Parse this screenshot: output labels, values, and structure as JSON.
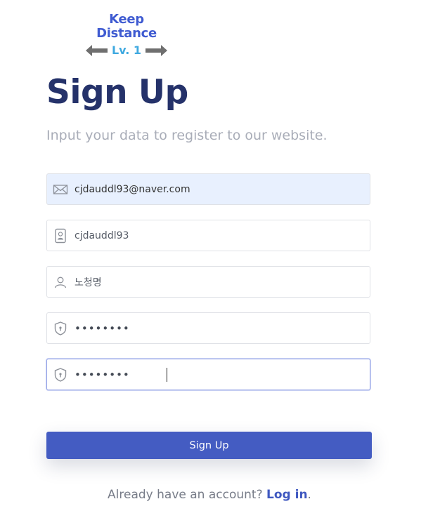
{
  "logo": {
    "line1": "Keep",
    "line2": "Distance",
    "level": "Lv. 1",
    "arrow_icon": "double-arrow-icon"
  },
  "title": "Sign Up",
  "subtitle": "Input your data to register to our website.",
  "form": {
    "email": {
      "value": "cjdauddl93@naver.com",
      "icon": "envelope-icon"
    },
    "user_id": {
      "value": "cjdauddl93",
      "icon": "id-card-icon"
    },
    "name": {
      "value": "노청명",
      "icon": "user-icon"
    },
    "password": {
      "value": "••••••••",
      "icon": "shield-icon"
    },
    "password_confirm": {
      "value": "••••••••",
      "icon": "shield-icon"
    }
  },
  "submit_label": "Sign Up",
  "footer": {
    "prompt": "Already have an account?",
    "link": "Log in",
    "end": "."
  },
  "colors": {
    "title": "#25326a",
    "accent": "#445cc2",
    "logo_text": "#3f5bd1",
    "logo_level": "#3fa9e0",
    "autofill_bg": "#e8f0fe"
  }
}
